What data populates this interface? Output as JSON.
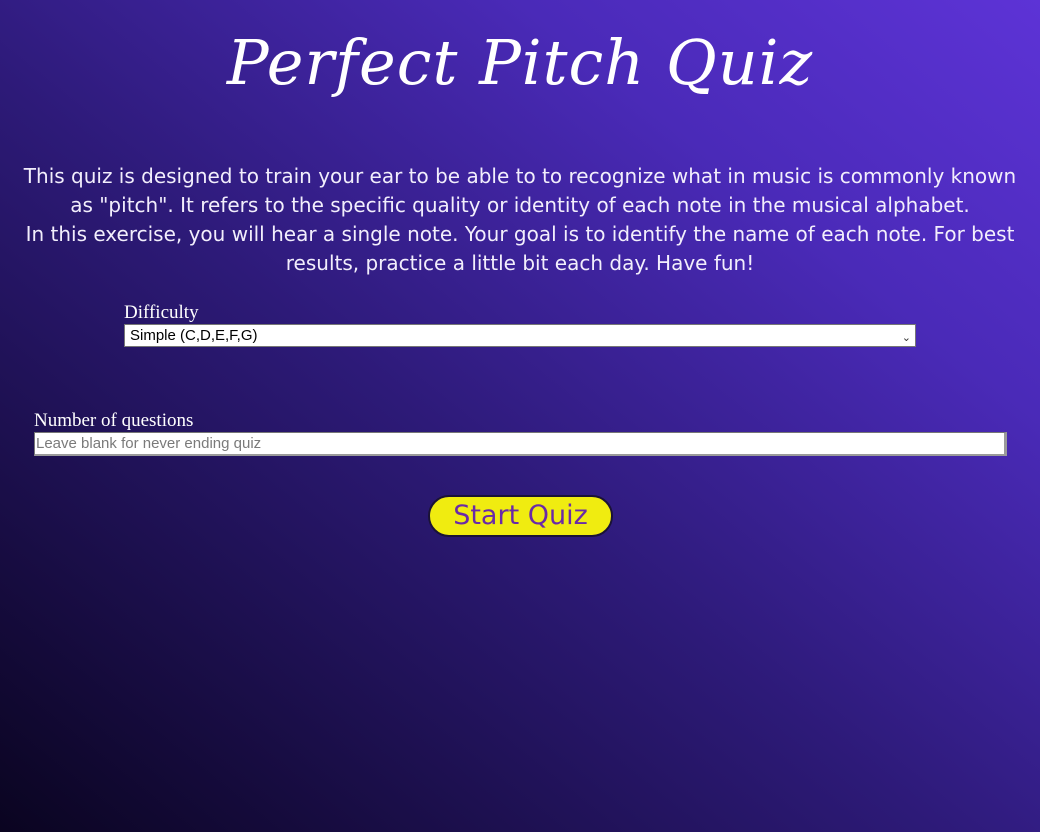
{
  "header": {
    "title": "Perfect Pitch Quiz"
  },
  "intro": {
    "paragraph1": "This quiz is designed to train your ear to be able to to recognize what in music is commonly known as \"pitch\". It refers to the specific quality or identity of each note in the musical alphabet.",
    "paragraph2": "In this exercise, you will hear a single note. Your goal is to identify the name of each note. For best results, practice a little bit each day. Have fun!"
  },
  "difficulty": {
    "label": "Difficulty",
    "selected": "Simple (C,D,E,F,G)",
    "icon": "chevron-down-icon"
  },
  "questions": {
    "label": "Number of questions",
    "value": "",
    "placeholder": "Leave blank for never ending quiz"
  },
  "start_button": {
    "label": "Start Quiz"
  },
  "colors": {
    "background_top": "#5d33d6",
    "background_bottom": "#0a0420",
    "button_bg": "#f0ec10",
    "button_text": "#6a2aa8"
  }
}
